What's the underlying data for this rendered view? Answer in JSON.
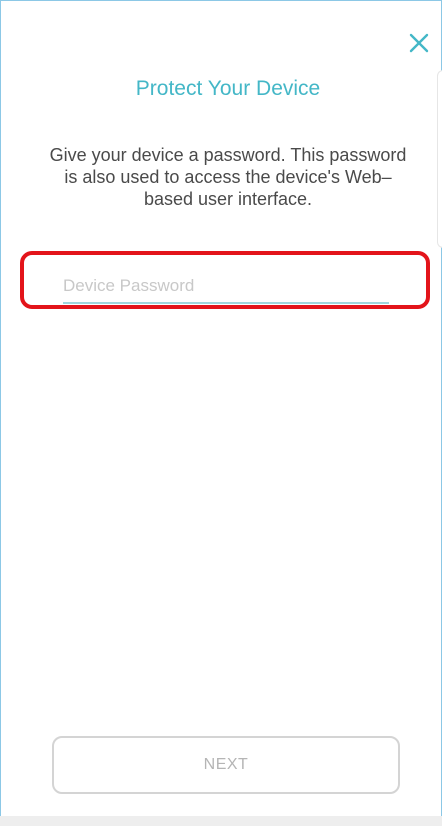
{
  "screen": {
    "title": "Protect Your Device",
    "description": "Give your device a password. This password is also used to access the device's Web–based user interface."
  },
  "password": {
    "placeholder": "Device Password",
    "value": ""
  },
  "actions": {
    "next_label": "NEXT",
    "close_icon": "close-icon"
  },
  "colors": {
    "accent": "#44b7c7",
    "highlight": "#e3141a",
    "frame_border": "#8cc8e6"
  }
}
